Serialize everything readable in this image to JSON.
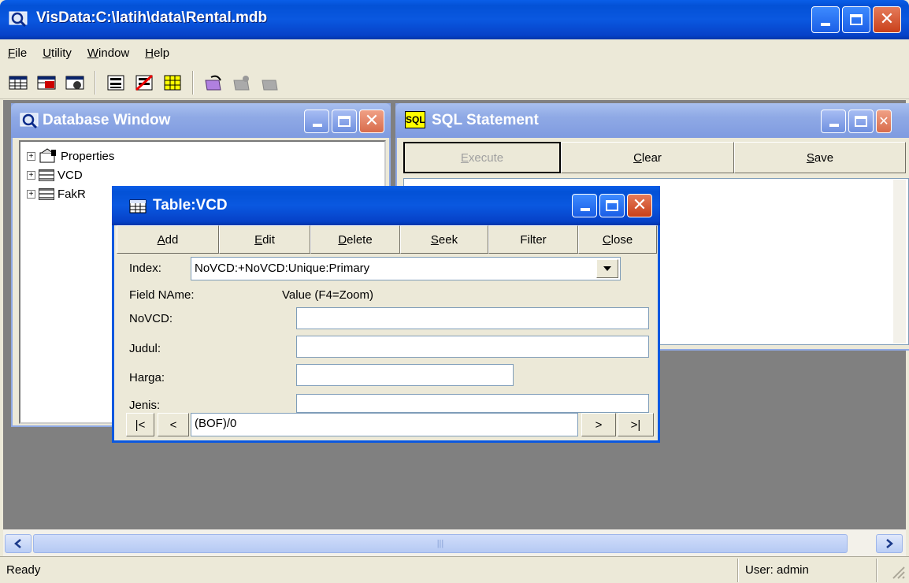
{
  "window": {
    "title": "VisData:C:\\latih\\data\\Rental.mdb"
  },
  "menu": [
    "File",
    "Utility",
    "Window",
    "Help"
  ],
  "toolbar_icons": [
    "table-icon",
    "dynaset-icon",
    "snapshot-icon",
    "data-control-icon",
    "no-data-control-icon",
    "grid-icon",
    "begin-trans-icon",
    "commit-icon",
    "rollback-icon"
  ],
  "database_window": {
    "title": "Database Window",
    "items": [
      "Properties",
      "VCD",
      "FakR"
    ]
  },
  "sql_window": {
    "title": "SQL Statement",
    "icon_text": "SQL",
    "buttons": {
      "execute": "Execute",
      "clear": "Clear",
      "save": "Save"
    }
  },
  "table_window": {
    "title": "Table:VCD",
    "buttons": {
      "add": "Add",
      "edit": "Edit",
      "delete": "Delete",
      "seek": "Seek",
      "filter": "Filter",
      "close": "Close"
    },
    "index_label": "Index:",
    "index_value": "NoVCD:+NoVCD:Unique:Primary",
    "field_header": "Field NAme:",
    "value_header": "Value (F4=Zoom)",
    "fields": [
      "NoVCD:",
      "Judul:",
      "Harga:",
      "Jenis:"
    ],
    "nav": {
      "first": "|<",
      "prev": "<",
      "position": "(BOF)/0",
      "next": ">",
      "last": ">|"
    }
  },
  "status": {
    "left": "Ready",
    "right": "User: admin"
  },
  "colors": {
    "title_blue": "#0a58e0",
    "inactive_title": "#8fa9e5",
    "mdi_bg": "#808080",
    "face": "#ece9d8"
  }
}
